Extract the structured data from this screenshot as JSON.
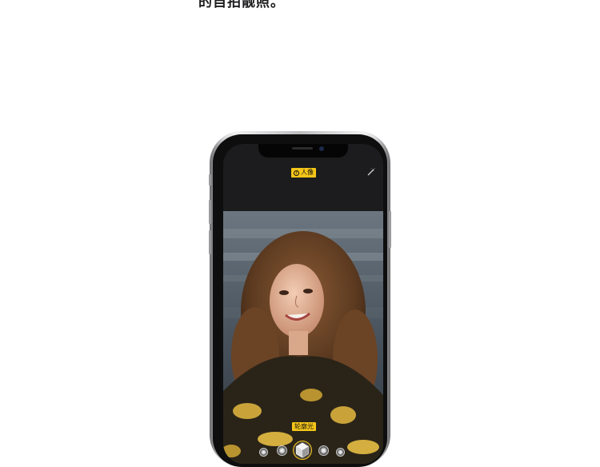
{
  "caption": {
    "text": "的自拍靓照。"
  },
  "camera": {
    "mode_label": "人像",
    "mode_icon": "f-aperture-icon",
    "effect_icon": "magic-wand-icon",
    "lighting_label": "轮廓光",
    "lighting_options": [
      "natural-light",
      "studio-light",
      "contour-light",
      "stage-light",
      "stage-light-mono"
    ]
  },
  "colors": {
    "badge_yellow": "#f5c518",
    "screen_bg": "#1c1c1e"
  }
}
